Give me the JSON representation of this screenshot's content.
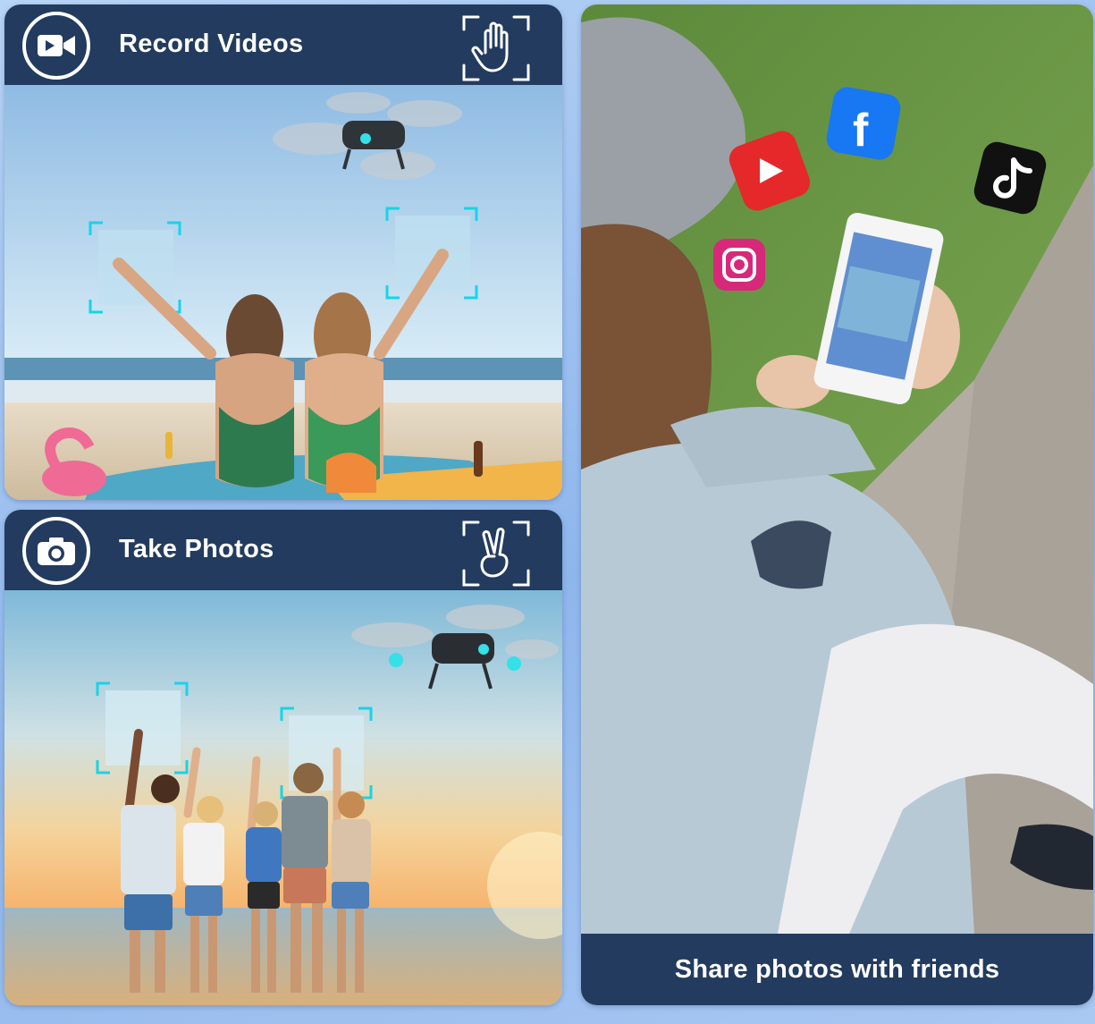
{
  "panels": {
    "record": {
      "title": "Record Videos",
      "icon": "video-camera-icon",
      "gesture": "open-palm-gesture-icon"
    },
    "photo": {
      "title": "Take Photos",
      "icon": "photo-camera-icon",
      "gesture": "victory-gesture-icon"
    },
    "share": {
      "caption": "Share photos with friends"
    }
  },
  "social_apps": [
    "youtube-icon",
    "facebook-icon",
    "tiktok-icon",
    "instagram-icon"
  ],
  "colors": {
    "header_navy": "#223b5f",
    "frame_cyan": "#19d3e6",
    "background_blue": "#9fc0ef"
  }
}
